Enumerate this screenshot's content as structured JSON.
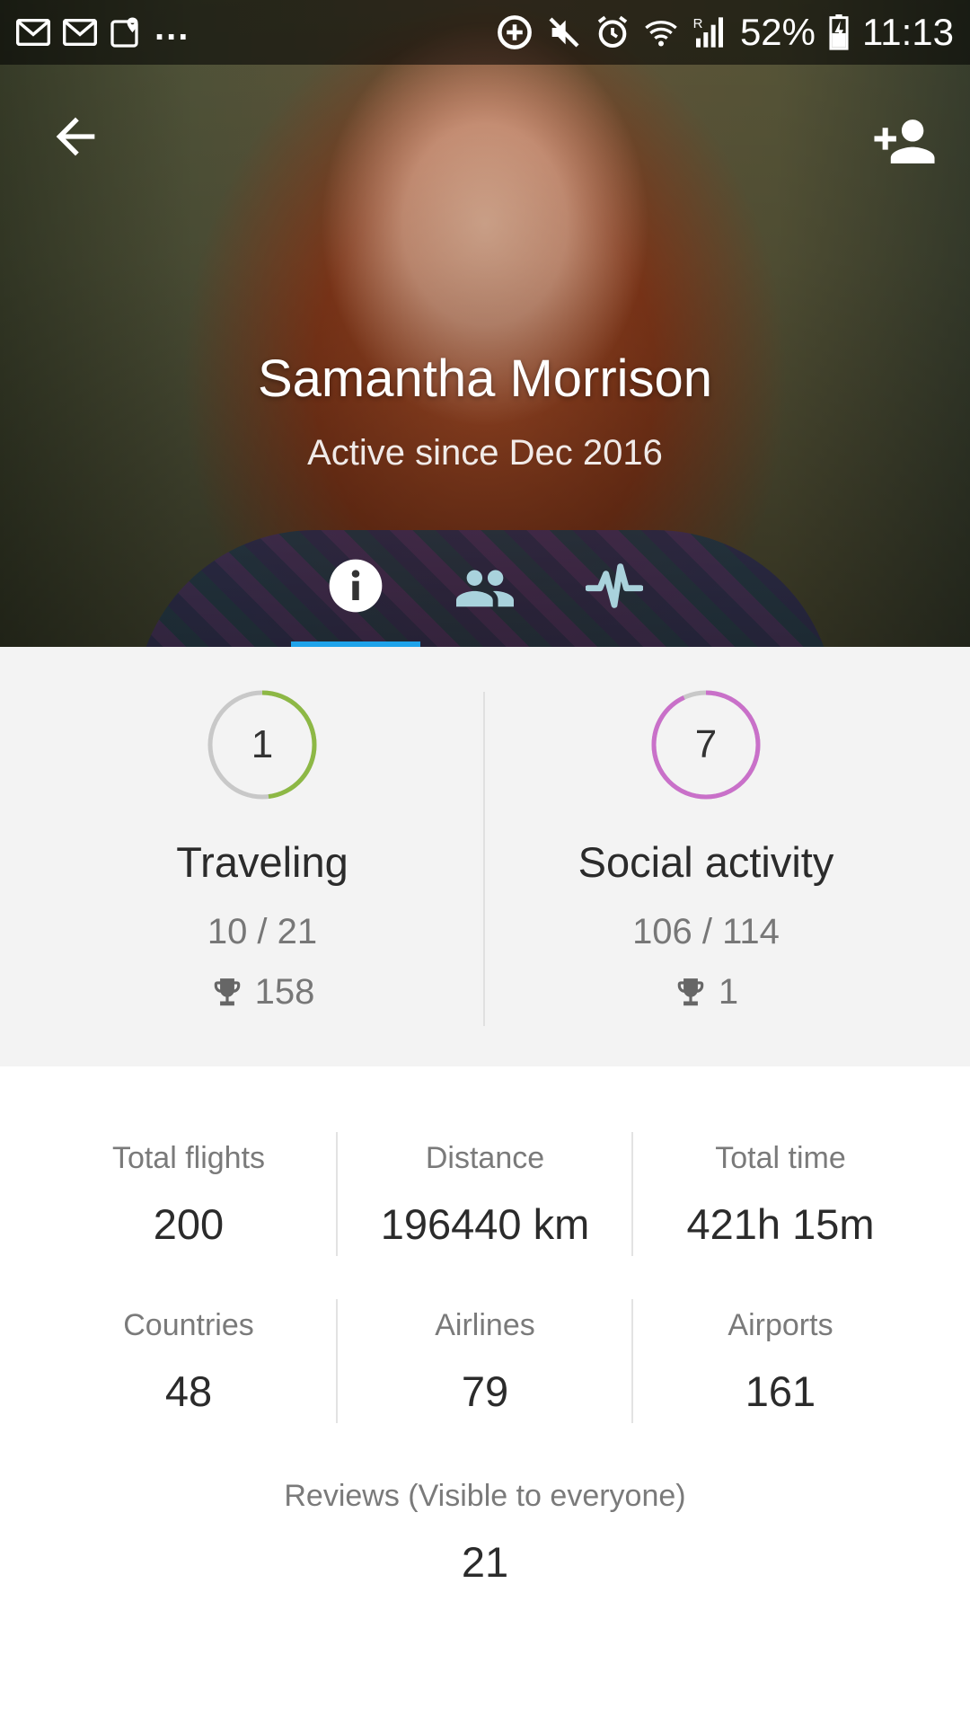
{
  "status_bar": {
    "left_icons": [
      "gmail-icon",
      "gmail-icon",
      "maps-icon"
    ],
    "overflow": "...",
    "right_icons": [
      "data-saver-icon",
      "mute-icon",
      "alarm-icon",
      "wifi-icon",
      "signal-icon"
    ],
    "battery": "52%",
    "time": "11:13"
  },
  "header": {
    "back_icon": "arrow-back-icon",
    "add_icon": "person-add-icon",
    "name": "Samantha Morrison",
    "subtitle": "Active since Dec 2016"
  },
  "tabs": [
    {
      "icon": "info-icon",
      "active": true
    },
    {
      "icon": "people-icon",
      "active": false
    },
    {
      "icon": "activity-icon",
      "active": false
    }
  ],
  "colors": {
    "tab_indicator": "#1ea3ea",
    "tab_icon_inactive": "#a9d2dc",
    "traveling_ring": "#8db845",
    "social_ring": "#c970c9",
    "ring_track": "#c8c8c8"
  },
  "achievements": [
    {
      "level": "1",
      "title": "Traveling",
      "progress": "10 / 21",
      "trophies": "158",
      "ring_fraction": 0.48
    },
    {
      "level": "7",
      "title": "Social activity",
      "progress": "106 / 114",
      "trophies": "1",
      "ring_fraction": 0.93
    }
  ],
  "stats": [
    {
      "label": "Total flights",
      "value": "200"
    },
    {
      "label": "Distance",
      "value": "196440 km"
    },
    {
      "label": "Total time",
      "value": "421h 15m"
    },
    {
      "label": "Countries",
      "value": "48"
    },
    {
      "label": "Airlines",
      "value": "79"
    },
    {
      "label": "Airports",
      "value": "161"
    }
  ],
  "reviews": {
    "label": "Reviews (Visible to everyone)",
    "value": "21"
  }
}
